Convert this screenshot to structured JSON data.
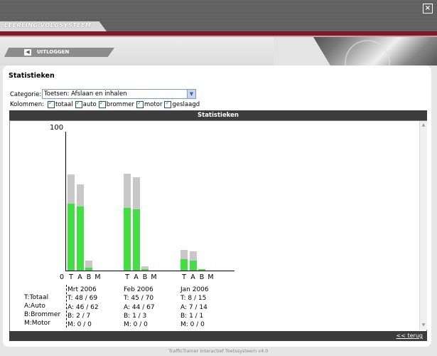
{
  "header": {
    "brand": "LEERLING VOLGSYSTEEM",
    "close_icon": "close-icon",
    "logout_label": "UITLOGGEN",
    "logout_icon": "arrow-left-icon"
  },
  "page": {
    "title": "Statistieken"
  },
  "filters": {
    "category_label": "Categorie:",
    "category_value": "Toetsen: Afslaan en inhalen",
    "columns_label": "Kolommen:",
    "columns": [
      "totaal",
      "auto",
      "brommer",
      "motor",
      "geslaagd"
    ]
  },
  "stats": {
    "header": "Statistieken",
    "back_link": "<< terug"
  },
  "chart_data": {
    "type": "bar",
    "ymax_label": "100",
    "ymin_label": "0",
    "ylim": [
      0,
      100
    ],
    "bar_letters": [
      "T",
      "A",
      "B",
      "M"
    ],
    "legend": [
      "T:Totaal",
      "A:Auto",
      "B:Brommer",
      "M:Motor"
    ],
    "groups": [
      {
        "label": "Mrt 2006",
        "T": "T: 48 / 69",
        "A": "A: 46 / 62",
        "B": "B: 2 / 7",
        "M": "M: 0 / 0",
        "series": [
          {
            "letter": "T",
            "passed": 48,
            "total": 69
          },
          {
            "letter": "A",
            "passed": 46,
            "total": 62
          },
          {
            "letter": "B",
            "passed": 2,
            "total": 7
          },
          {
            "letter": "M",
            "passed": 0,
            "total": 0
          }
        ]
      },
      {
        "label": "Feb 2006",
        "T": "T: 45 / 70",
        "A": "A: 44 / 67",
        "B": "B: 1 / 3",
        "M": "M: 0 / 0",
        "series": [
          {
            "letter": "T",
            "passed": 45,
            "total": 70
          },
          {
            "letter": "A",
            "passed": 44,
            "total": 67
          },
          {
            "letter": "B",
            "passed": 1,
            "total": 3
          },
          {
            "letter": "M",
            "passed": 0,
            "total": 0
          }
        ]
      },
      {
        "label": "Jan 2006",
        "T": "T: 8 / 15",
        "A": "A: 7 / 14",
        "B": "B: 1 / 1",
        "M": "M: 0 / 0",
        "series": [
          {
            "letter": "T",
            "passed": 8,
            "total": 15
          },
          {
            "letter": "A",
            "passed": 7,
            "total": 14
          },
          {
            "letter": "B",
            "passed": 1,
            "total": 1
          },
          {
            "letter": "M",
            "passed": 0,
            "total": 0
          }
        ]
      }
    ],
    "colors": {
      "total": "#c8c8c8",
      "passed": "#44dd44"
    }
  },
  "footer": {
    "credit": "TrafficTrainer Interactief Toetssysteem v4.0"
  }
}
